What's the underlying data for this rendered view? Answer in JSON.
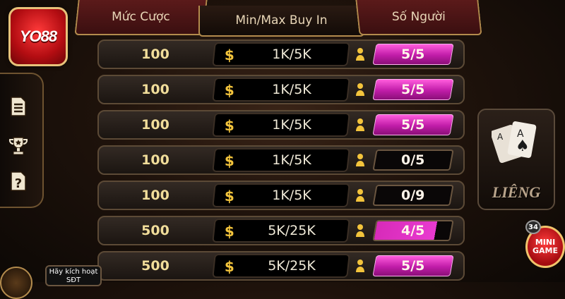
{
  "brand": {
    "logo_text": "YO88"
  },
  "header": {
    "col_bet": "Mức Cược",
    "col_buyin": "Min/Max Buy In",
    "col_players": "Số Người"
  },
  "sidebar": {
    "icons": [
      "document-icon",
      "trophy-icon",
      "help-icon"
    ]
  },
  "rows": [
    {
      "bet": "100",
      "buyin": "1K/5K",
      "players": "5/5",
      "fill": 1.0
    },
    {
      "bet": "100",
      "buyin": "1K/5K",
      "players": "5/5",
      "fill": 1.0
    },
    {
      "bet": "100",
      "buyin": "1K/5K",
      "players": "5/5",
      "fill": 1.0
    },
    {
      "bet": "100",
      "buyin": "1K/5K",
      "players": "0/5",
      "fill": 0.0
    },
    {
      "bet": "100",
      "buyin": "1K/5K",
      "players": "0/9",
      "fill": 0.0
    },
    {
      "bet": "500",
      "buyin": "5K/25K",
      "players": "4/5",
      "fill": 0.8
    },
    {
      "bet": "500",
      "buyin": "5K/25K",
      "players": "5/5",
      "fill": 1.0
    }
  ],
  "game_card": {
    "label": "LIÊNG"
  },
  "mini_game": {
    "badge": "34",
    "line1": "MINI",
    "line2": "GAME"
  },
  "promo": {
    "line1": "Hãy kích hoạt",
    "line2": "SĐT"
  },
  "colors": {
    "accent": "#d72bb9",
    "gold": "#f3c43c",
    "border": "#b38b4d"
  }
}
